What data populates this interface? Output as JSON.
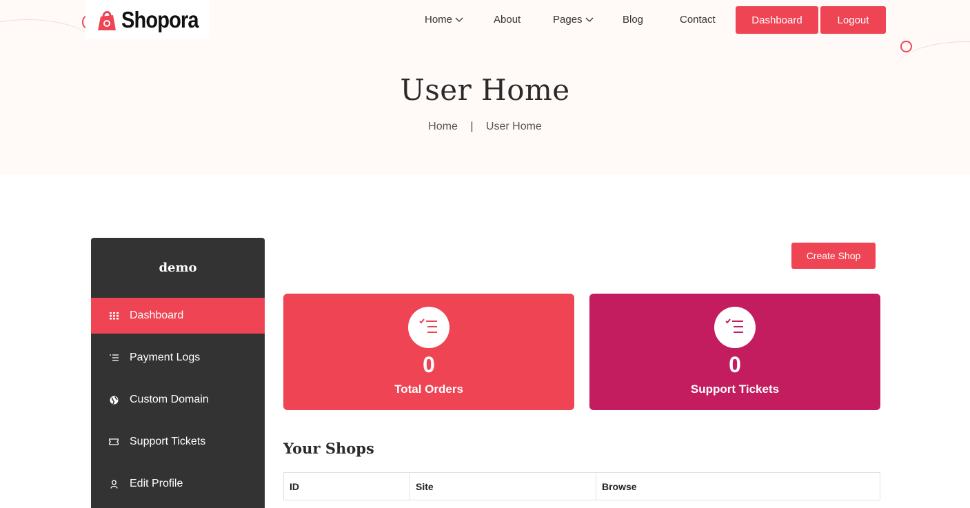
{
  "brand": {
    "name": "Shopora",
    "accent": "#ef4453",
    "secondary": "#c41d5f",
    "sidebar_bg": "#333333"
  },
  "nav": {
    "items": [
      {
        "label": "Home",
        "has_dropdown": true
      },
      {
        "label": "About",
        "has_dropdown": false
      },
      {
        "label": "Pages",
        "has_dropdown": true
      },
      {
        "label": "Blog",
        "has_dropdown": false
      },
      {
        "label": "Contact",
        "has_dropdown": false
      }
    ],
    "dashboard_label": "Dashboard",
    "logout_label": "Logout"
  },
  "hero": {
    "title": "User Home",
    "breadcrumb": [
      "Home",
      "User Home"
    ],
    "separator": "|"
  },
  "sidebar": {
    "username": "demo",
    "items": [
      {
        "label": "Dashboard",
        "icon": "grid-icon",
        "active": true
      },
      {
        "label": "Payment Logs",
        "icon": "list-icon",
        "active": false
      },
      {
        "label": "Custom Domain",
        "icon": "globe-icon",
        "active": false
      },
      {
        "label": "Support Tickets",
        "icon": "ticket-icon",
        "active": false
      },
      {
        "label": "Edit Profile",
        "icon": "user-icon",
        "active": false
      }
    ]
  },
  "main": {
    "create_shop_label": "Create Shop",
    "stats": [
      {
        "value": "0",
        "label": "Total Orders",
        "icon": "checklist-icon",
        "color": "#ef4453"
      },
      {
        "value": "0",
        "label": "Support Tickets",
        "icon": "checklist-icon",
        "color": "#c41d5f"
      }
    ],
    "shops_heading": "Your Shops",
    "table_headers": [
      "ID",
      "Site",
      "Browse"
    ]
  }
}
